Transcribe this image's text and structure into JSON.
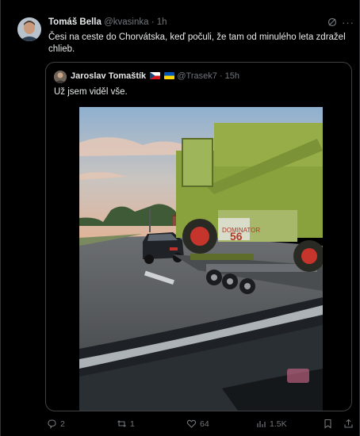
{
  "tweet": {
    "author_name": "Tomáš Bella",
    "handle": "@kvasinka",
    "separator": "·",
    "time": "1h",
    "text": "Česi na ceste do Chorvátska, keď počuli, že tam od minulého leta zdražel chlieb.",
    "more_label": "···"
  },
  "quote": {
    "author_name": "Jaroslav Tomaštík",
    "flags": [
      "cz-flag",
      "ua-flag"
    ],
    "handle": "@Trasek7",
    "separator": "·",
    "time": "15h",
    "text": "Už jsem viděl vše.",
    "photo": {
      "description_icons": [
        "combine-harvester",
        "trailer",
        "car",
        "road"
      ],
      "vehicle_number": "56",
      "vehicle_brand": "DOMINATOR"
    }
  },
  "actions": {
    "replies": "2",
    "reposts": "1",
    "likes": "64",
    "views": "1.5K"
  },
  "colors": {
    "background": "#000000",
    "text": "#e7e9ea",
    "muted": "#71767b",
    "border": "#2f3336"
  }
}
